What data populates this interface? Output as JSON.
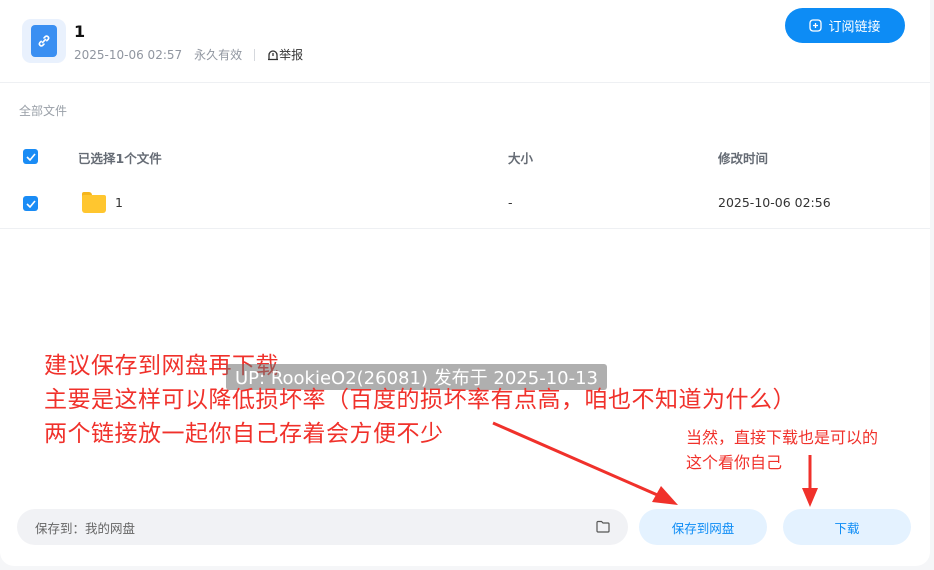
{
  "header": {
    "title": "1",
    "date": "2025-10-06 02:57",
    "validity": "永久有效",
    "report": "举报",
    "subscribe": "订阅链接",
    "icon": "link-icon"
  },
  "breadcrumb": "全部文件",
  "table": {
    "headers": {
      "name": "已选择1个文件",
      "size": "大小",
      "modified": "修改时间"
    },
    "rows": [
      {
        "name": "1",
        "size": "-",
        "modified": "2025-10-06 02:56",
        "checked": true,
        "icon": "folder-icon"
      }
    ]
  },
  "footer": {
    "save_to": "保存到：我的网盘",
    "save_button": "保存到网盘",
    "download_button": "下载"
  },
  "annotations": {
    "line1": "建议保存到网盘再下载",
    "line2": "主要是这样可以降低损坏率（百度的损坏率有点高，咱也不知道为什么）",
    "line3": "两个链接放一起你自己存着会方便不少",
    "side1": "当然，直接下载也是可以的",
    "side2": "这个看你自己"
  },
  "watermark": "UP: RookieO2(26081) 发布于 2025-10-13",
  "colors": {
    "accent": "#0d8cf5",
    "annotation": "#f0312b"
  }
}
